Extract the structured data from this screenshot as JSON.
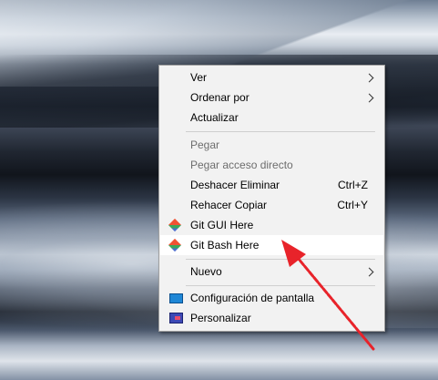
{
  "menu": {
    "items": [
      {
        "label": "Ver"
      },
      {
        "label": "Ordenar por"
      },
      {
        "label": "Actualizar"
      },
      {
        "label": "Pegar"
      },
      {
        "label": "Pegar acceso directo"
      },
      {
        "label": "Deshacer Eliminar",
        "shortcut": "Ctrl+Z"
      },
      {
        "label": "Rehacer Copiar",
        "shortcut": "Ctrl+Y"
      },
      {
        "label": "Git GUI Here",
        "icon": "git-icon"
      },
      {
        "label": "Git Bash Here",
        "icon": "git-icon"
      },
      {
        "label": "Nuevo"
      },
      {
        "label": "Configuración de pantalla",
        "icon": "display-settings-icon"
      },
      {
        "label": "Personalizar",
        "icon": "personalize-icon"
      }
    ]
  },
  "colors": {
    "menu_bg": "#f2f2f2",
    "hover_bg": "#ffffff",
    "disabled_text": "#6d6d6d",
    "annotation_arrow": "#e8232a"
  }
}
